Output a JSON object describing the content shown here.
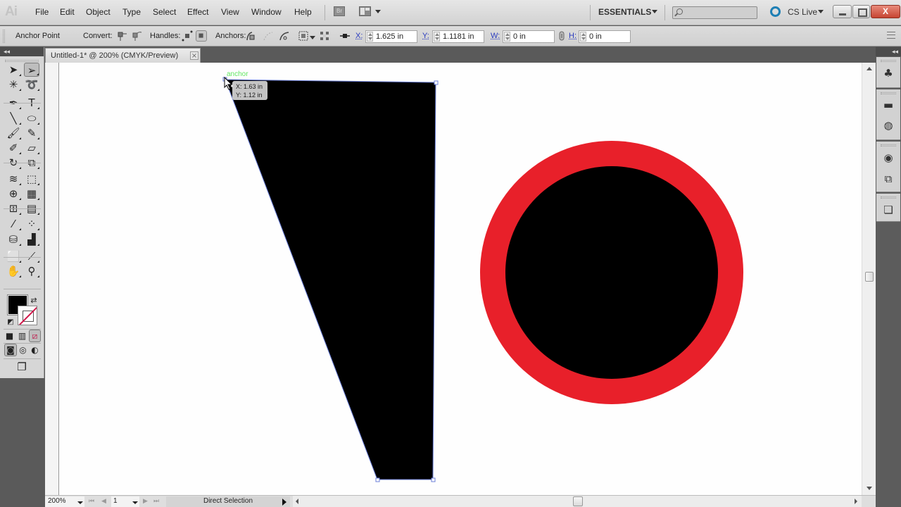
{
  "app": {
    "logo": "Ai",
    "document_tab": "Untitled-1* @ 200% (CMYK/Preview)",
    "colors": {
      "fill": "#000000",
      "ring": "#e8202a",
      "selection": "#6b7fd8",
      "smart_guide": "#62e862"
    }
  },
  "menubar": {
    "items": [
      "File",
      "Edit",
      "Object",
      "Type",
      "Select",
      "Effect",
      "View",
      "Window",
      "Help"
    ],
    "bridge_label": "Br",
    "workspace": "ESSENTIALS",
    "search_placeholder": "",
    "cs_live": "CS Live",
    "window_controls": {
      "close": "X"
    }
  },
  "controlbar": {
    "context_label": "Anchor Point",
    "convert_label": "Convert:",
    "handles_label": "Handles:",
    "anchors_label": "Anchors:",
    "x_label": "X:",
    "x_value": "1.625 in",
    "y_label": "Y:",
    "y_value": "1.1181 in",
    "w_label": "W:",
    "w_value": "0 in",
    "h_label": "H:",
    "h_value": "0 in"
  },
  "tools": {
    "collapse": "◂◂",
    "items": [
      {
        "name": "selection-tool",
        "glyph": "➤"
      },
      {
        "name": "direct-selection-tool",
        "glyph": "➢",
        "active": true
      },
      {
        "name": "magic-wand-tool",
        "glyph": "✳"
      },
      {
        "name": "lasso-tool",
        "glyph": "➰"
      },
      {
        "name": "pen-tool",
        "glyph": "✒"
      },
      {
        "name": "type-tool",
        "glyph": "T"
      },
      {
        "name": "line-segment-tool",
        "glyph": "╲"
      },
      {
        "name": "ellipse-tool",
        "glyph": "⬭"
      },
      {
        "name": "paintbrush-tool",
        "glyph": "🖌"
      },
      {
        "name": "pencil-tool",
        "glyph": "✎"
      },
      {
        "name": "blob-brush-tool",
        "glyph": "✐"
      },
      {
        "name": "eraser-tool",
        "glyph": "▱"
      },
      {
        "name": "rotate-tool",
        "glyph": "↻"
      },
      {
        "name": "scale-tool",
        "glyph": "⧉"
      },
      {
        "name": "warp-tool",
        "glyph": "≋"
      },
      {
        "name": "free-transform-tool",
        "glyph": "⬚"
      },
      {
        "name": "shape-builder-tool",
        "glyph": "⊕"
      },
      {
        "name": "perspective-grid-tool",
        "glyph": "▦"
      },
      {
        "name": "mesh-tool",
        "glyph": "⊞"
      },
      {
        "name": "gradient-tool",
        "glyph": "▤"
      },
      {
        "name": "eyedropper-tool",
        "glyph": "⁄"
      },
      {
        "name": "blend-tool",
        "glyph": "⁘"
      },
      {
        "name": "symbol-sprayer-tool",
        "glyph": "⛁"
      },
      {
        "name": "column-graph-tool",
        "glyph": "▟"
      },
      {
        "name": "artboard-tool",
        "glyph": "⬜"
      },
      {
        "name": "slice-tool",
        "glyph": "⟋"
      },
      {
        "name": "hand-tool",
        "glyph": "✋"
      },
      {
        "name": "zoom-tool",
        "glyph": "⚲"
      }
    ],
    "swap_glyph": "⇄",
    "color_modes": [
      "■",
      "▥",
      "⧄"
    ],
    "draw_modes": [
      "◙",
      "◎",
      "◐"
    ],
    "screen_mode": "❐"
  },
  "canvas": {
    "anchor_label": "anchor",
    "tooltip_x": "X: 1.63 in",
    "tooltip_y": "Y: 1.12 in"
  },
  "statusbar": {
    "zoom": "200%",
    "page": "1",
    "status": "Direct Selection",
    "nav_first": "⏮",
    "nav_prev": "◀",
    "nav_next": "▶",
    "nav_last": "⏭"
  },
  "dock": {
    "collapse": "◂◂",
    "icons": [
      {
        "name": "symbols-panel-icon",
        "glyph": "♣"
      },
      {
        "name": "gradient-panel-icon",
        "glyph": "▬"
      },
      {
        "name": "transparency-panel-icon",
        "glyph": "◍"
      },
      {
        "name": "appearance-panel-icon",
        "glyph": "◉"
      },
      {
        "name": "graphic-styles-panel-icon",
        "glyph": "⧉"
      },
      {
        "name": "layers-panel-icon",
        "glyph": "❏"
      }
    ]
  }
}
